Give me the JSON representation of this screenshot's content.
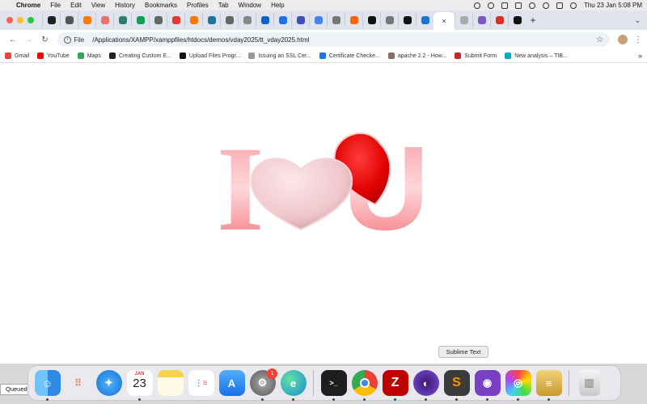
{
  "menubar": {
    "app_name": "Chrome",
    "menus": [
      "File",
      "Edit",
      "View",
      "History",
      "Bookmarks",
      "Profiles",
      "Tab",
      "Window",
      "Help"
    ],
    "clock": "Thu 23 Jan  5:08 PM"
  },
  "tabs": {
    "favicon_colors": [
      "#222222",
      "#555555",
      "#f57c00",
      "#e57373",
      "#2e7d6b",
      "#0f9d58",
      "#666666",
      "#e53935",
      "#f57c00",
      "#21759b",
      "#666666",
      "#888888",
      "#0a66c2",
      "#1a73e8",
      "#3f51b5",
      "#4285f4",
      "#777777",
      "#ff6600",
      "#111111",
      "#777777",
      "#111111",
      "#1976d2",
      "#aaaaaa",
      "#7e57c2",
      "#d93025",
      "#111111"
    ],
    "active_close": "×",
    "new_tab": "+"
  },
  "toolbar": {
    "scheme": "File",
    "url": "/Applications/XAMPP/xamppfiles/htdocs/demos/vday2025/tt_vday2025.html"
  },
  "bookmarks": [
    {
      "label": "Gmail",
      "color": "#ea4335"
    },
    {
      "label": "YouTube",
      "color": "#ff0000"
    },
    {
      "label": "Maps",
      "color": "#34a853"
    },
    {
      "label": "Creating Custom E...",
      "color": "#222222"
    },
    {
      "label": "Upload Files Progr...",
      "color": "#111111"
    },
    {
      "label": "Issuing an SSL Cer...",
      "color": "#999999"
    },
    {
      "label": "Certificate Checke...",
      "color": "#1a73e8"
    },
    {
      "label": "apache 2.2 - How...",
      "color": "#8d6e63"
    },
    {
      "label": "Submit Form",
      "color": "#c62828"
    },
    {
      "label": "New analysis – TIB...",
      "color": "#00acc1"
    }
  ],
  "bookmarks_more": "»",
  "page": {
    "letter_left": "I",
    "letter_right": "U"
  },
  "dock": {
    "calendar_month": "JAN",
    "calendar_day": "23",
    "settings_badge": "1",
    "tooltip": "Sublime Text",
    "queued_label": "Queued"
  }
}
